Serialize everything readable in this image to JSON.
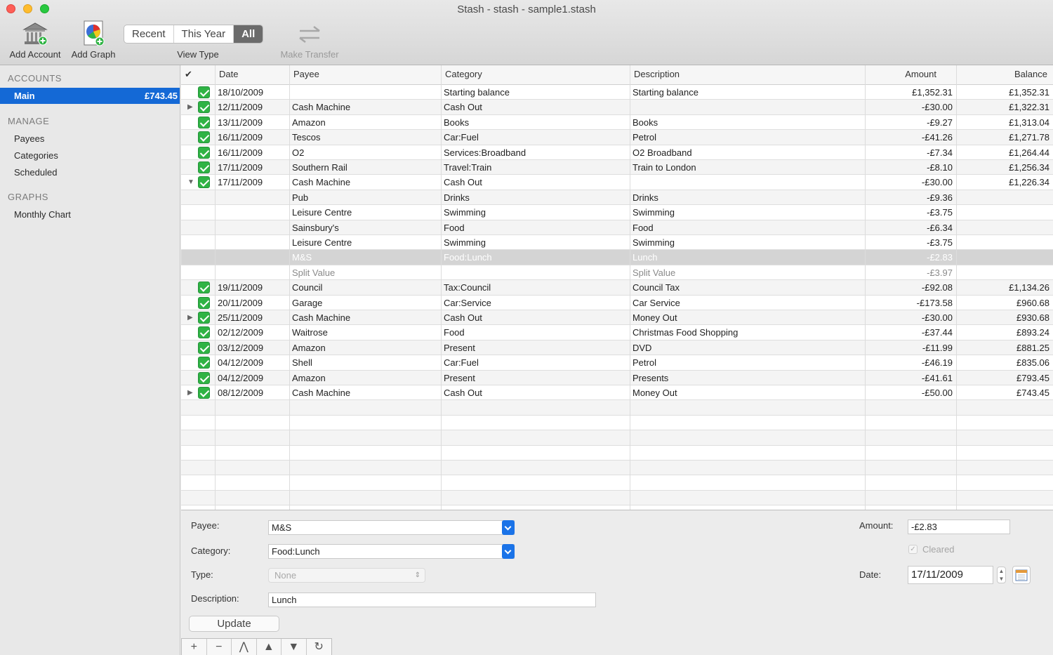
{
  "window": {
    "title": "Stash - stash - sample1.stash"
  },
  "toolbar": {
    "add_account": "Add Account",
    "add_graph": "Add Graph",
    "view_type_label": "View Type",
    "view_types": [
      "Recent",
      "This Year",
      "All"
    ],
    "view_type_selected": "All",
    "make_transfer": "Make Transfer"
  },
  "sidebar": {
    "accounts_header": "ACCOUNTS",
    "accounts": [
      {
        "name": "Main",
        "balance": "£743.45"
      }
    ],
    "manage_header": "MANAGE",
    "manage_items": [
      "Payees",
      "Categories",
      "Scheduled"
    ],
    "graphs_header": "GRAPHS",
    "graph_items": [
      "Monthly Chart"
    ]
  },
  "table": {
    "columns": [
      "✔",
      "Date",
      "Payee",
      "Category",
      "Description",
      "Amount",
      "Balance"
    ],
    "rows": [
      {
        "check": true,
        "expander": "",
        "date": "18/10/2009",
        "payee": "",
        "category": "Starting balance",
        "description": "Starting balance",
        "amount": "£1,352.31",
        "balance": "£1,352.31"
      },
      {
        "check": true,
        "expander": "▶",
        "date": "12/11/2009",
        "payee": "Cash Machine",
        "category": "Cash Out",
        "description": "",
        "amount": "-£30.00",
        "balance": "£1,322.31"
      },
      {
        "check": true,
        "expander": "",
        "date": "13/11/2009",
        "payee": "Amazon",
        "category": "Books",
        "description": "Books",
        "amount": "-£9.27",
        "balance": "£1,313.04"
      },
      {
        "check": true,
        "expander": "",
        "date": "16/11/2009",
        "payee": "Tescos",
        "category": "Car:Fuel",
        "description": "Petrol",
        "amount": "-£41.26",
        "balance": "£1,271.78"
      },
      {
        "check": true,
        "expander": "",
        "date": "16/11/2009",
        "payee": "O2",
        "category": "Services:Broadband",
        "description": "O2 Broadband",
        "amount": "-£7.34",
        "balance": "£1,264.44"
      },
      {
        "check": true,
        "expander": "",
        "date": "17/11/2009",
        "payee": "Southern Rail",
        "category": "Travel:Train",
        "description": "Train to London",
        "amount": "-£8.10",
        "balance": "£1,256.34"
      },
      {
        "check": true,
        "expander": "▼",
        "date": "17/11/2009",
        "payee": "Cash Machine",
        "category": "Cash Out",
        "description": "",
        "amount": "-£30.00",
        "balance": "£1,226.34"
      },
      {
        "check": false,
        "expander": "",
        "date": "",
        "payee": "Pub",
        "category": "Drinks",
        "description": "Drinks",
        "amount": "-£9.36",
        "balance": ""
      },
      {
        "check": false,
        "expander": "",
        "date": "",
        "payee": "Leisure Centre",
        "category": "Swimming",
        "description": "Swimming",
        "amount": "-£3.75",
        "balance": ""
      },
      {
        "check": false,
        "expander": "",
        "date": "",
        "payee": "Sainsbury's",
        "category": "Food",
        "description": "Food",
        "amount": "-£6.34",
        "balance": ""
      },
      {
        "check": false,
        "expander": "",
        "date": "",
        "payee": "Leisure Centre",
        "category": "Swimming",
        "description": "Swimming",
        "amount": "-£3.75",
        "balance": ""
      },
      {
        "check": false,
        "expander": "",
        "date": "",
        "payee": "M&S",
        "category": "Food:Lunch",
        "description": "Lunch",
        "amount": "-£2.83",
        "balance": "",
        "selected": true
      },
      {
        "check": false,
        "expander": "",
        "date": "",
        "payee": "Split Value",
        "category": "",
        "description": "Split Value",
        "amount": "-£3.97",
        "balance": "",
        "dim": true
      },
      {
        "check": true,
        "expander": "",
        "date": "19/11/2009",
        "payee": "Council",
        "category": "Tax:Council",
        "description": "Council Tax",
        "amount": "-£92.08",
        "balance": "£1,134.26"
      },
      {
        "check": true,
        "expander": "",
        "date": "20/11/2009",
        "payee": "Garage",
        "category": "Car:Service",
        "description": "Car Service",
        "amount": "-£173.58",
        "balance": "£960.68"
      },
      {
        "check": true,
        "expander": "▶",
        "date": "25/11/2009",
        "payee": "Cash Machine",
        "category": "Cash Out",
        "description": "Money Out",
        "amount": "-£30.00",
        "balance": "£930.68"
      },
      {
        "check": true,
        "expander": "",
        "date": "02/12/2009",
        "payee": "Waitrose",
        "category": "Food",
        "description": "Christmas Food Shopping",
        "amount": "-£37.44",
        "balance": "£893.24"
      },
      {
        "check": true,
        "expander": "",
        "date": "03/12/2009",
        "payee": "Amazon",
        "category": "Present",
        "description": "DVD",
        "amount": "-£11.99",
        "balance": "£881.25"
      },
      {
        "check": true,
        "expander": "",
        "date": "04/12/2009",
        "payee": "Shell",
        "category": "Car:Fuel",
        "description": "Petrol",
        "amount": "-£46.19",
        "balance": "£835.06"
      },
      {
        "check": true,
        "expander": "",
        "date": "04/12/2009",
        "payee": "Amazon",
        "category": "Present",
        "description": "Presents",
        "amount": "-£41.61",
        "balance": "£793.45"
      },
      {
        "check": true,
        "expander": "▶",
        "date": "08/12/2009",
        "payee": "Cash Machine",
        "category": "Cash Out",
        "description": "Money Out",
        "amount": "-£50.00",
        "balance": "£743.45"
      }
    ]
  },
  "editor": {
    "payee_label": "Payee:",
    "payee_value": "M&S",
    "category_label": "Category:",
    "category_value": "Food:Lunch",
    "type_label": "Type:",
    "type_value": "None",
    "description_label": "Description:",
    "description_value": "Lunch",
    "amount_label": "Amount:",
    "amount_value": "-£2.83",
    "cleared_label": "Cleared",
    "date_label": "Date:",
    "date_value": "17/11/2009",
    "update_button": "Update"
  },
  "bottom_bar": [
    "+",
    "−",
    "⋀",
    "▲",
    "▼",
    "↻"
  ]
}
